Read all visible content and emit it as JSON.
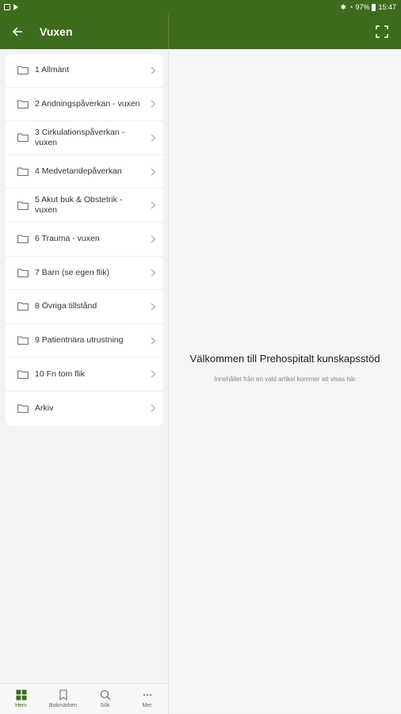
{
  "status_bar": {
    "battery": "97%",
    "time": "15:47"
  },
  "header": {
    "title": "Vuxen"
  },
  "list": {
    "items": [
      {
        "label": "1 Allmänt"
      },
      {
        "label": "2 Andningspåverkan - vuxen"
      },
      {
        "label": "3 Cirkulationspåverkan - vuxen"
      },
      {
        "label": "4 Medvetandepåverkan"
      },
      {
        "label": "5 Akut buk & Obstetrik - vuxen"
      },
      {
        "label": "6 Trauma - vuxen"
      },
      {
        "label": "7 Barn (se egen flik)"
      },
      {
        "label": "8 Övriga tillstånd"
      },
      {
        "label": "9 Patientnära utrustning"
      },
      {
        "label": "10 Fn tom flik"
      },
      {
        "label": "Arkiv"
      }
    ]
  },
  "content": {
    "welcome_title": "Välkommen till Prehospitalt kunskapsstöd",
    "welcome_subtitle": "Innehållet från en vald artikel kommer att visas här"
  },
  "bottom_nav": {
    "items": [
      {
        "label": "Hem",
        "icon": "home-grid-icon"
      },
      {
        "label": "Bokmärken",
        "icon": "bookmark-icon"
      },
      {
        "label": "Sök",
        "icon": "search-icon"
      },
      {
        "label": "Mer",
        "icon": "more-icon"
      }
    ]
  },
  "colors": {
    "primary": "#3e6b1d",
    "background": "#f3f3f3"
  }
}
